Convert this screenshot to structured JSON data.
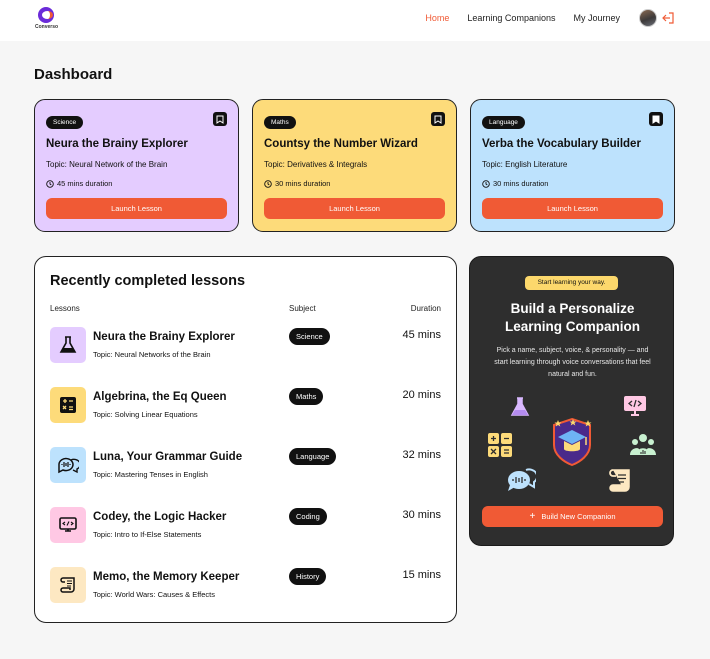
{
  "app": {
    "logo_text": "Converso"
  },
  "nav": {
    "links": [
      {
        "label": "Home",
        "active": true
      },
      {
        "label": "Learning Companions",
        "active": false
      },
      {
        "label": "My Journey",
        "active": false
      }
    ]
  },
  "page": {
    "title": "Dashboard"
  },
  "cards": [
    {
      "subject": "Science",
      "name": "Neura the Brainy Explorer",
      "topic": "Topic: Neural Network of the Brain",
      "duration": "45 mins duration",
      "button": "Launch Lesson",
      "bookmarked": false,
      "color": "#e4ccff"
    },
    {
      "subject": "Maths",
      "name": "Countsy the Number Wizard",
      "topic": "Topic: Derivatives & Integrals",
      "duration": "30 mins duration",
      "button": "Launch Lesson",
      "bookmarked": false,
      "color": "#fddb7a"
    },
    {
      "subject": "Language",
      "name": "Verba the Vocabulary Builder",
      "topic": "Topic: English Literature",
      "duration": "30 mins duration",
      "button": "Launch Lesson",
      "bookmarked": true,
      "color": "#bde2fd"
    }
  ],
  "recent": {
    "title": "Recently completed lessons",
    "headers": {
      "lessons": "Lessons",
      "subject": "Subject",
      "duration": "Duration"
    },
    "rows": [
      {
        "icon": "flask-icon",
        "icon_bg": "#e4ccff",
        "name": "Neura the Brainy Explorer",
        "topic": "Topic: Neural Networks of the Brain",
        "subject": "Science",
        "duration": "45 mins"
      },
      {
        "icon": "calculator-icon",
        "icon_bg": "#fddb7a",
        "name": "Algebrina, the Eq Queen",
        "topic": "Topic: Solving Linear Equations",
        "subject": "Maths",
        "duration": "20 mins"
      },
      {
        "icon": "speech-bubbles-icon",
        "icon_bg": "#bde2fd",
        "name": "Luna, Your Grammar Guide",
        "topic": "Topic: Mastering Tenses in English",
        "subject": "Language",
        "duration": "32 mins"
      },
      {
        "icon": "code-monitor-icon",
        "icon_bg": "#ffc8e4",
        "name": "Codey, the Logic Hacker",
        "topic": "Topic: Intro to If-Else Statements",
        "subject": "Coding",
        "duration": "30 mins"
      },
      {
        "icon": "scroll-icon",
        "icon_bg": "#fde8c2",
        "name": "Memo, the Memory Keeper",
        "topic": "Topic: World Wars: Causes & Effects",
        "subject": "History",
        "duration": "15 mins"
      }
    ]
  },
  "cta": {
    "pill": "Start learning your way.",
    "title_line1": "Build a Personalize",
    "title_line2": "Learning Companion",
    "desc": "Pick a name, subject, voice, & personality — and start learning through voice conversations that feel natural and fun.",
    "button": "Build New Companion"
  },
  "colors": {
    "accent": "#f05a35",
    "dark": "#111111",
    "panel": "#2e2e2e"
  }
}
